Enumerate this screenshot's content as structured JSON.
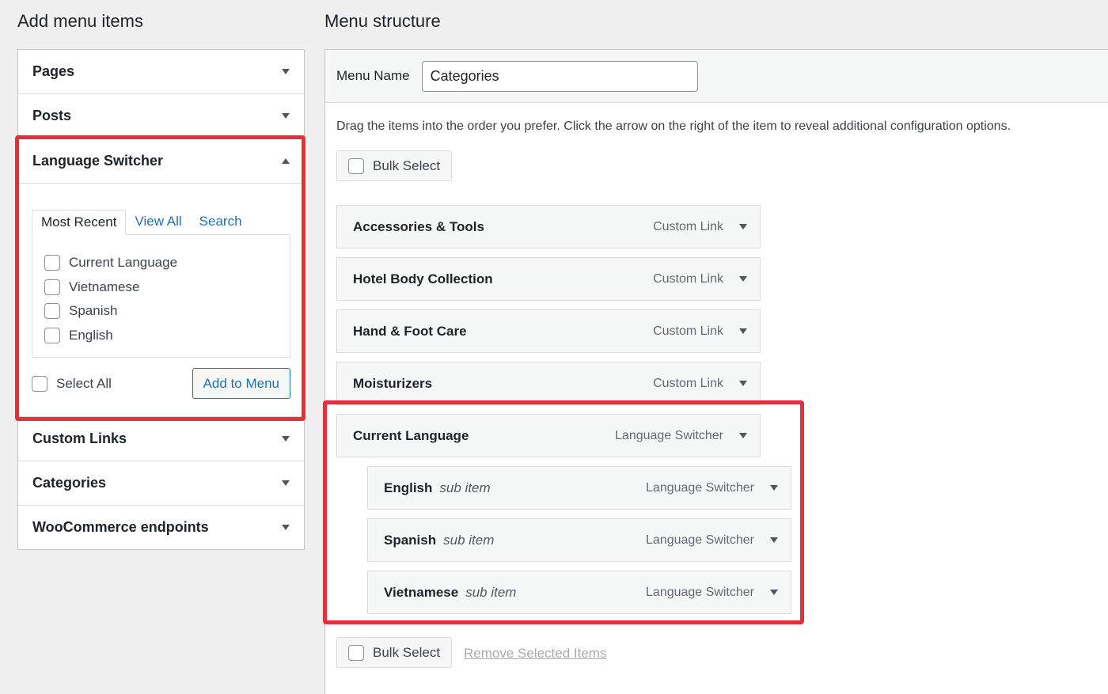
{
  "left": {
    "title": "Add menu items",
    "sections": {
      "pages": "Pages",
      "posts": "Posts",
      "language_switcher": "Language Switcher",
      "custom_links": "Custom Links",
      "categories": "Categories",
      "woocommerce": "WooCommerce endpoints"
    },
    "tabs": {
      "most_recent": "Most Recent",
      "view_all": "View All",
      "search": "Search"
    },
    "options": [
      "Current Language",
      "Vietnamese",
      "Spanish",
      "English"
    ],
    "select_all": "Select All",
    "add_to_menu": "Add to Menu"
  },
  "right": {
    "title": "Menu structure",
    "menu_name_label": "Menu Name",
    "menu_name_value": "Categories",
    "instructions": "Drag the items into the order you prefer. Click the arrow on the right of the item to reveal additional configuration options.",
    "bulk_select": "Bulk Select",
    "remove_selected": "Remove Selected Items",
    "items": [
      {
        "title": "Accessories & Tools",
        "sub": "",
        "type": "Custom Link"
      },
      {
        "title": "Hotel Body Collection",
        "sub": "",
        "type": "Custom Link"
      },
      {
        "title": "Hand & Foot Care",
        "sub": "",
        "type": "Custom Link"
      },
      {
        "title": "Moisturizers",
        "sub": "",
        "type": "Custom Link"
      },
      {
        "title": "Current Language",
        "sub": "",
        "type": "Language Switcher"
      },
      {
        "title": "English",
        "sub": "sub item",
        "type": "Language Switcher"
      },
      {
        "title": "Spanish",
        "sub": "sub item",
        "type": "Language Switcher"
      },
      {
        "title": "Vietnamese",
        "sub": "sub item",
        "type": "Language Switcher"
      }
    ]
  },
  "colors": {
    "highlight": "#e5303c",
    "link": "#2271b1"
  }
}
